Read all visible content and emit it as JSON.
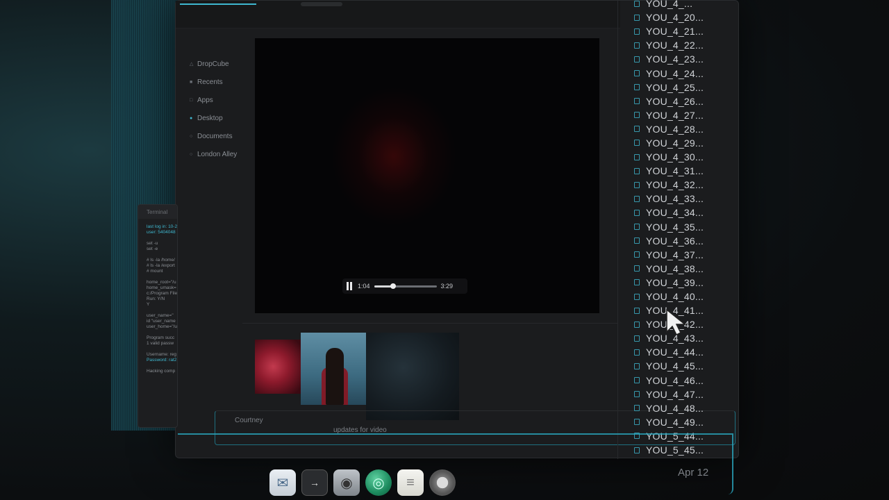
{
  "sidebar": {
    "items": [
      {
        "label": "DropCube"
      },
      {
        "label": "Recents"
      },
      {
        "label": "Apps"
      },
      {
        "label": "Desktop"
      },
      {
        "label": "Documents"
      },
      {
        "label": "London Alley"
      }
    ]
  },
  "player": {
    "current_time": "1:04",
    "duration": "3:29",
    "progress": 0.306
  },
  "terminal": {
    "title": "Terminal",
    "lines": [
      "last log in: 10-2",
      "user: 5404048",
      "",
      "set -u",
      "set -e",
      "",
      "# ls -la /home/",
      "# ls -la /export",
      "# mount",
      "",
      "home_root=\"/u",
      "home_umask=",
      "c:/Program File",
      "Run: Y/N",
      "Y",
      "",
      "user_name=\"",
      "id \"user_name",
      "user_home=\"/u",
      "",
      "Program succ",
      "1 valid passw",
      "",
      "Username: reg",
      "Password: rat2",
      "",
      "Hacking comp"
    ]
  },
  "files": [
    "YOU_4_...",
    "YOU_4_20...",
    "YOU_4_21...",
    "YOU_4_22...",
    "YOU_4_23...",
    "YOU_4_24...",
    "YOU_4_25...",
    "YOU_4_26...",
    "YOU_4_27...",
    "YOU_4_28...",
    "YOU_4_29...",
    "YOU_4_30...",
    "YOU_4_31...",
    "YOU_4_32...",
    "YOU_4_33...",
    "YOU_4_34...",
    "YOU_4_35...",
    "YOU_4_36...",
    "YOU_4_37...",
    "YOU_4_38...",
    "YOU_4_39...",
    "YOU_4_40...",
    "YOU_4_41...",
    "YOU_4_42...",
    "YOU_4_43...",
    "YOU_4_44...",
    "YOU_4_45...",
    "YOU_4_46...",
    "YOU_4_47...",
    "YOU_4_48...",
    "YOU_4_49...",
    "YOU_5_44...",
    "YOU_5_45..."
  ],
  "message": {
    "sender": "Courtney",
    "text": "updates for video",
    "date": "Apr 12"
  },
  "dock": {
    "icons": [
      "mail-icon",
      "terminal-icon",
      "camera-icon",
      "globe-icon",
      "notes-icon",
      "browser-icon"
    ]
  },
  "colors": {
    "accent": "#3fb8d0",
    "window": "#1b1c1e",
    "video": "#050506"
  }
}
